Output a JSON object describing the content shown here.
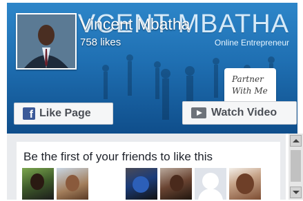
{
  "cover": {
    "brand_text": "VCENT MBATHA",
    "tagline": "Online Entrepreneur",
    "partner_line1": "Partner",
    "partner_line2": "With Me"
  },
  "page": {
    "name": "Vincent Mbatha",
    "likes": "758 likes"
  },
  "buttons": {
    "like_page": "Like Page",
    "watch_video": "Watch Video"
  },
  "friends": {
    "prompt": "Be the first of your friends to like this"
  },
  "icons": {
    "facebook": "facebook-f-icon",
    "video": "video-play-icon"
  },
  "colors": {
    "cover_blue": "#1f6fb2",
    "facebook_blue": "#3b5998",
    "button_bg": "#f5f6f7"
  }
}
